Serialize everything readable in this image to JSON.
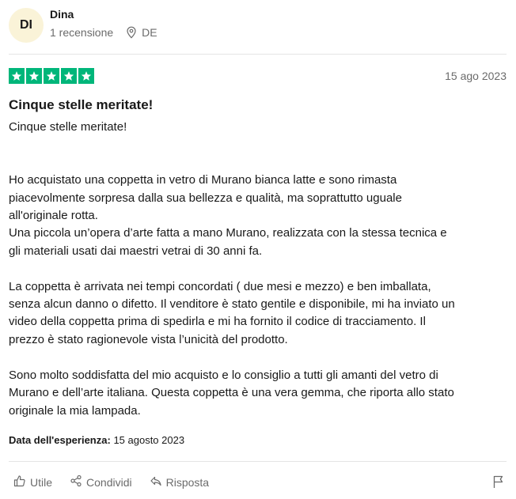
{
  "reviewer": {
    "initials": "DI",
    "name": "Dina",
    "review_count": "1 recensione",
    "country": "DE"
  },
  "review": {
    "rating": 5,
    "date": "15 ago 2023",
    "title": "Cinque stelle meritate!",
    "body": "Cinque stelle meritate!\n\n\nHo acquistato una coppetta in vetro di Murano bianca latte e sono rimasta\npiacevolmente sorpresa dalla sua bellezza e qualità, ma soprattutto uguale\nall'originale rotta.\nUna piccola un’opera d’arte fatta a mano Murano, realizzata con la stessa tecnica e\ngli materiali usati dai maestri vetrai di 30 anni fa.\n\nLa coppetta è arrivata nei tempi concordati ( due mesi e mezzo) e ben imballata,\nsenza alcun danno o difetto. Il venditore è stato gentile e disponibile, mi ha inviato un\nvideo della coppetta prima di spedirla e mi ha fornito il codice di tracciamento. Il\nprezzo è stato ragionevole vista l’unicità del prodotto.\n\nSono molto soddisfatta del mio acquisto e lo consiglio a tutti gli amanti del vetro di\nMurano e dell’arte italiana. Questa coppetta è una vera gemma, che riporta allo stato\noriginale la mia lampada.",
    "experience_label": "Data dell'esperienza:",
    "experience_date": "15 agosto 2023"
  },
  "actions": {
    "like_label": "Utile",
    "share_label": "Condividi",
    "reply_label": "Risposta"
  },
  "colors": {
    "star_green": "#00b67a",
    "avatar_bg": "#faf3d8",
    "muted_text": "#6b6b6b"
  },
  "icons": [
    "map-pin-icon",
    "star-icon",
    "thumbs-up-icon",
    "share-icon",
    "reply-icon",
    "flag-icon"
  ]
}
